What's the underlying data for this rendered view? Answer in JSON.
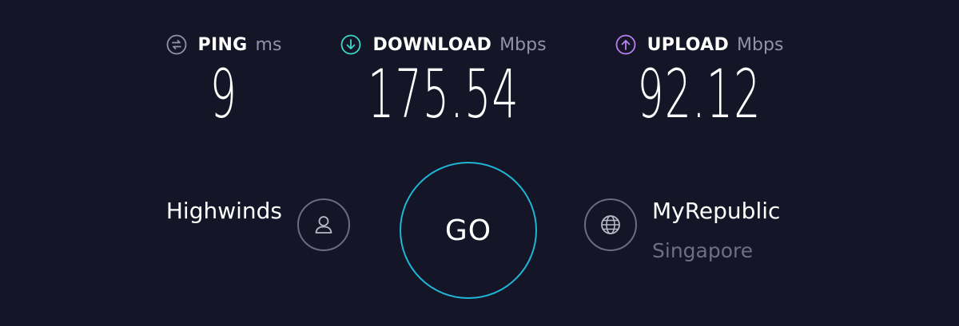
{
  "colors": {
    "background": "#141526",
    "ping_icon": "#9193a8",
    "download_icon": "#3fd5c6",
    "upload_icon": "#b880f0",
    "go_ring": "#1fb5d5",
    "unit_text": "#9193a8",
    "muted_text": "#6d6f84"
  },
  "metrics": {
    "ping": {
      "label": "PING",
      "unit": "ms",
      "value": "9",
      "icon": "ping-icon"
    },
    "download": {
      "label": "DOWNLOAD",
      "unit": "Mbps",
      "value": "175.54",
      "icon": "download-arrow-icon"
    },
    "upload": {
      "label": "UPLOAD",
      "unit": "Mbps",
      "value": "92.12",
      "icon": "upload-arrow-icon"
    }
  },
  "server": {
    "host": "Highwinds",
    "host_icon": "user-icon",
    "isp": "MyRepublic",
    "location": "Singapore",
    "isp_icon": "globe-icon"
  },
  "go_button": {
    "label": "GO"
  }
}
